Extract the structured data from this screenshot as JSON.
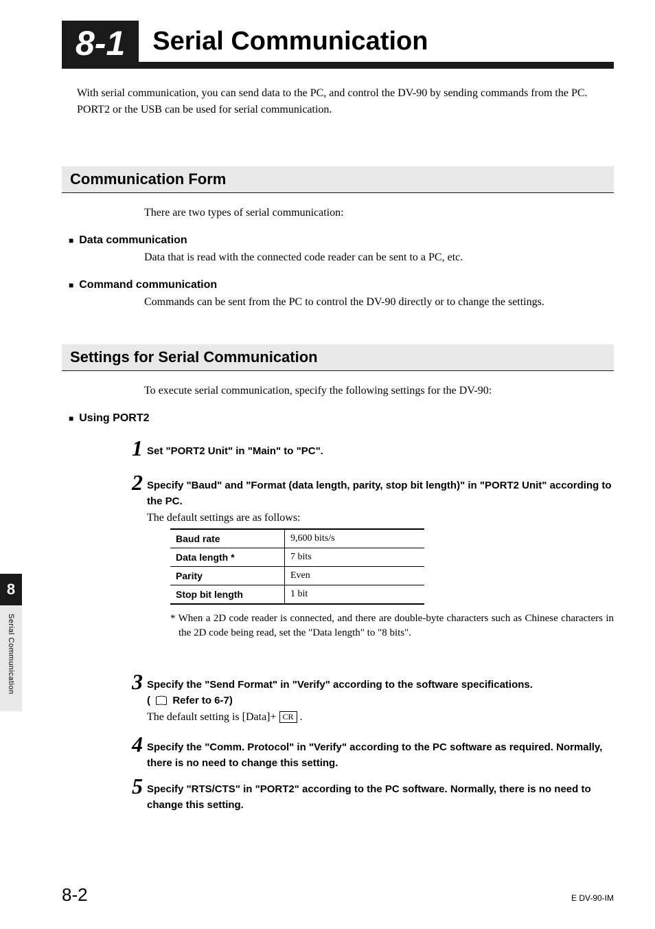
{
  "section": {
    "number": "8-1",
    "title": "Serial Communication"
  },
  "intro": {
    "p1": "With serial communication, you can send data to the PC, and control the DV-90 by sending commands from the PC.",
    "p2": "PORT2 or the USB can be used for serial communication."
  },
  "commForm": {
    "heading": "Communication Form",
    "intro": "There are two types of serial communication:",
    "items": [
      {
        "title": "Data communication",
        "body": "Data that is read with the connected code reader can be sent to a PC, etc."
      },
      {
        "title": "Command communication",
        "body": "Commands can be sent from the PC to control the DV-90 directly or to change the settings."
      }
    ]
  },
  "settings": {
    "heading": "Settings for Serial Communication",
    "intro": "To execute serial communication, specify the following settings for the DV-90:",
    "usingPort2": "Using PORT2",
    "steps": {
      "s1": {
        "num": "1",
        "title": "Set \"PORT2 Unit\" in \"Main\" to \"PC\"."
      },
      "s2": {
        "num": "2",
        "title": "Specify \"Baud\" and \"Format (data length, parity, stop bit length)\" in \"PORT2 Unit\" according to the PC.",
        "desc": "The default settings are as follows:"
      },
      "s3": {
        "num": "3",
        "title_a": "Specify the \"Send Format\" in \"Verify\" according to the software specifications.",
        "title_b_prefix": "( ",
        "title_b_ref": "Refer to 6-7)",
        "desc_prefix": "The default setting is [Data]+ ",
        "desc_box": "CR",
        "desc_suffix": " ."
      },
      "s4": {
        "num": "4",
        "title": "Specify the \"Comm. Protocol\" in \"Verify\" according to the PC software as required. Normally, there is no need to change this setting."
      },
      "s5": {
        "num": "5",
        "title": "Specify \"RTS/CTS\" in \"PORT2\" according to the PC software. Normally, there is no need to change this setting."
      }
    },
    "table": {
      "rows": [
        {
          "label": "Baud rate",
          "value": "9,600 bits/s"
        },
        {
          "label": "Data length *",
          "value": "7 bits"
        },
        {
          "label": "Parity",
          "value": "Even"
        },
        {
          "label": "Stop bit length",
          "value": "1 bit"
        }
      ]
    },
    "footnote": "* When a 2D code reader is connected, and there are double-byte characters such as Chinese characters in the 2D code being read, set the \"Data length\" to \"8 bits\"."
  },
  "sidebar": {
    "chapter": "8",
    "label": "Serial Communication"
  },
  "footer": {
    "page": "8-2",
    "docid": "E DV-90-IM"
  }
}
